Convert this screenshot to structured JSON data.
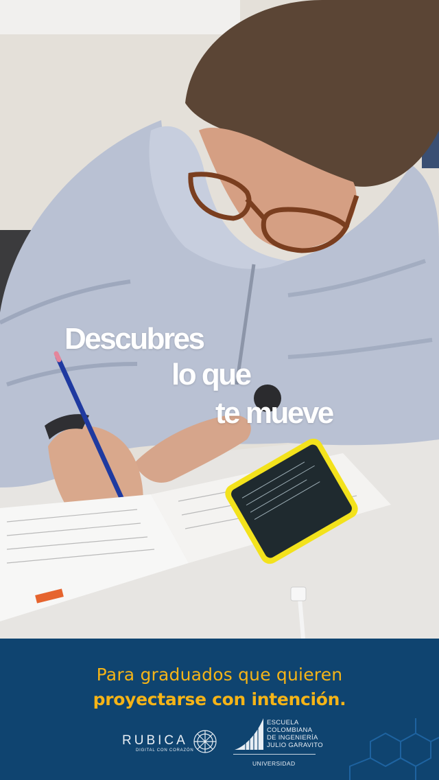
{
  "headline": {
    "line1": "Descubres",
    "line2": "lo que",
    "line3": "te mueve"
  },
  "tagline": {
    "line1": "Para graduados que quieren",
    "line2": "proyectarse con intención."
  },
  "logos": {
    "rubica_name": "RUBICA",
    "rubica_sub": "DIGITAL CON CORAZÓN",
    "university_lines": [
      "ESCUELA",
      "COLOMBIANA",
      "DE INGENIERÍA",
      "JULIO GARAVITO"
    ],
    "university_label": "UNIVERSIDAD"
  },
  "colors": {
    "footer_background": "#0f4470",
    "tagline_color": "#f5b417",
    "headline_color": "#ffffff",
    "phone_case": "#f3e21c"
  }
}
